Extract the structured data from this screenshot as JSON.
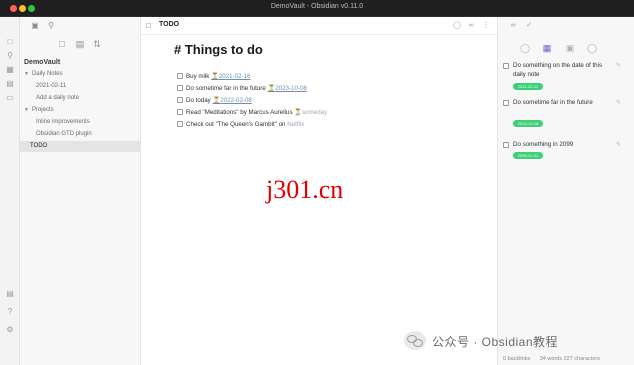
{
  "window": {
    "title": "DemoVault - Obsidian v0.11.0"
  },
  "ribbon": {
    "icons": [
      "open-quick-switcher-icon",
      "graph-view-icon",
      "calendar-icon",
      "templates-icon",
      "command-palette-icon",
      "vault-icon",
      "help-icon",
      "settings-icon"
    ]
  },
  "file_explorer": {
    "actions": [
      "new-note-icon",
      "new-folder-icon",
      "sort-icon"
    ],
    "vault_name": "DemoVault",
    "items": [
      {
        "label": "Daily Notes",
        "type": "folder"
      },
      {
        "label": "2021-02-11",
        "type": "file"
      },
      {
        "label": "Add a daily note",
        "type": "file"
      },
      {
        "label": "Projects",
        "type": "folder"
      },
      {
        "label": "Inline improvements",
        "type": "file"
      },
      {
        "label": "Obsidian GTD plugin",
        "type": "file"
      },
      {
        "label": "TODO",
        "type": "file",
        "selected": true
      }
    ]
  },
  "editor": {
    "tab_title": "TODO",
    "heading": "# Things to do",
    "tasks": [
      {
        "prefix": "Buy milk ",
        "date": "⏳2021-02-16",
        "suffix": ""
      },
      {
        "prefix": "Do sometime far in the future ",
        "date": "⏳2023-10-08",
        "suffix": ""
      },
      {
        "prefix": "Do today ",
        "date": "⏳2022-02-08",
        "suffix": ""
      },
      {
        "prefix": "Read \"Meditations\" by Marcus Aurelius ",
        "date": "",
        "suffix": "⏳someday"
      },
      {
        "prefix": "Check out \"The Queen's Gambit\" on ",
        "date": "",
        "suffix": "Netflix"
      }
    ]
  },
  "watermark": {
    "text": "j301.cn"
  },
  "reminder_pane": {
    "items": [
      {
        "text": "Do something on the date of this daily note",
        "pill": "2021-02-11"
      },
      {
        "text": "Do sometime far in the future",
        "pill": "2023-10-08"
      },
      {
        "text": "Do something in 2099",
        "pill": "2099-01-01"
      }
    ]
  },
  "status_bar": {
    "backlinks": "0 backlinks",
    "counts": "34 words  227 characters"
  },
  "overlay": {
    "wechat_text": "公众号 · Obsidian教程"
  },
  "colors": {
    "accent": "#7a56d8",
    "pill": "#3ecf78",
    "watermark": "#e00000"
  }
}
